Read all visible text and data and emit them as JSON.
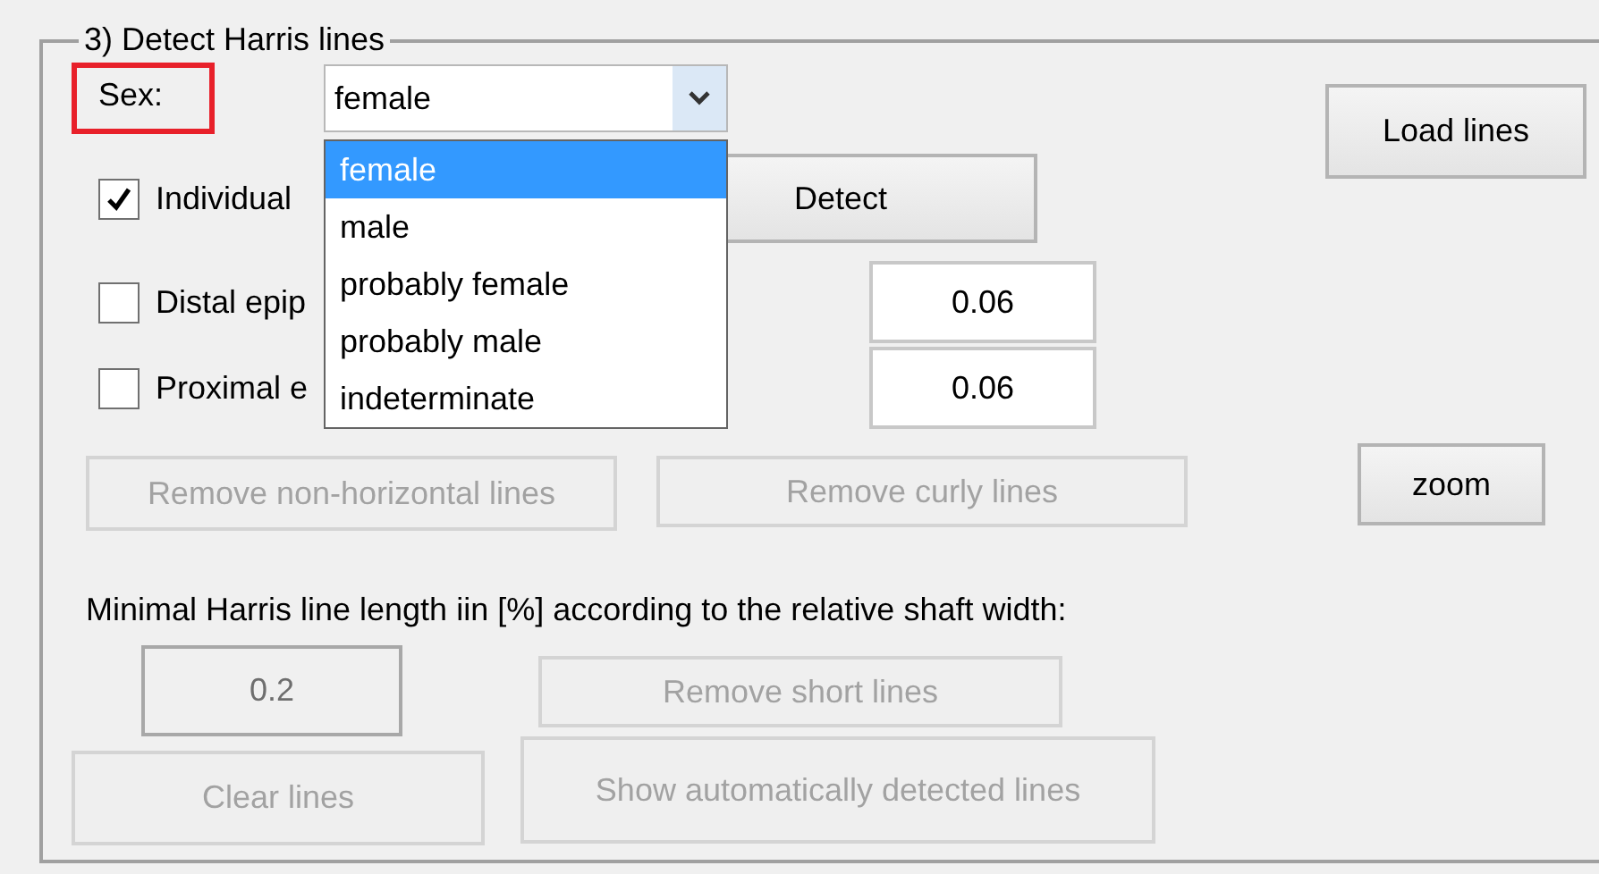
{
  "panel": {
    "title": "3) Detect Harris lines"
  },
  "sex": {
    "label": "Sex:",
    "highlighted": true,
    "value": "female",
    "expanded": true,
    "options": [
      {
        "label": "female",
        "selected": true
      },
      {
        "label": "male",
        "selected": false
      },
      {
        "label": "probably female",
        "selected": false
      },
      {
        "label": "probably male",
        "selected": false
      },
      {
        "label": "indeterminate",
        "selected": false
      }
    ]
  },
  "load_button": {
    "label": "Load lines",
    "disabled": false
  },
  "checkboxes": [
    {
      "label": "Individual",
      "checked": true
    },
    {
      "label": "Distal epip",
      "checked": false
    },
    {
      "label": "Proximal e",
      "checked": false
    }
  ],
  "detect_button": {
    "label": "Detect",
    "disabled": false
  },
  "thresholds": [
    {
      "value": "0.06",
      "disabled": false
    },
    {
      "value": "0.06",
      "disabled": false
    }
  ],
  "remove_nonhorizontal_button": {
    "label": "Remove non-horizontal lines",
    "disabled": true
  },
  "remove_curly_button": {
    "label": "Remove curly lines",
    "disabled": true
  },
  "zoom_button": {
    "label": "zoom",
    "disabled": false
  },
  "min_length_note": "Minimal Harris line length iin [%] according to the relative shaft width:",
  "min_length_field": {
    "value": "0.2",
    "disabled": true
  },
  "remove_short_button": {
    "label": "Remove short lines",
    "disabled": true
  },
  "clear_button": {
    "label": "Clear lines",
    "disabled": true
  },
  "show_auto_button": {
    "label": "Show automatically detected lines",
    "disabled": true
  }
}
